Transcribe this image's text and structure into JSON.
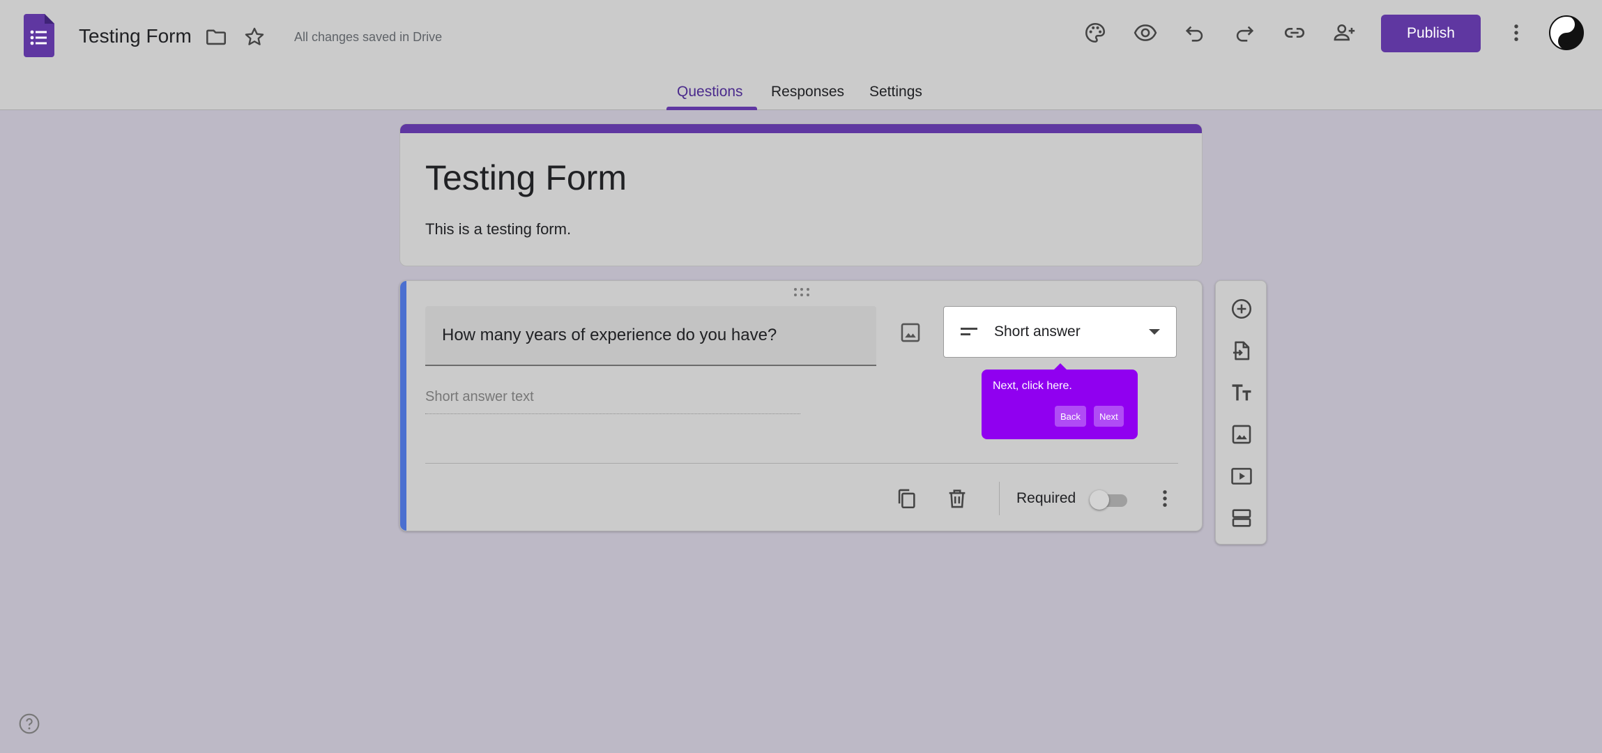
{
  "app": {
    "logo_icon": "google-forms-icon"
  },
  "header": {
    "doc_title": "Testing Form",
    "save_status": "All changes saved in Drive",
    "publish_label": "Publish",
    "icons": [
      "folder-icon",
      "star-icon",
      "palette-icon",
      "preview-eye-icon",
      "undo-icon",
      "redo-icon",
      "link-icon",
      "add-collaborator-icon",
      "more-vert-icon"
    ]
  },
  "tabs": [
    {
      "label": "Questions",
      "active": true
    },
    {
      "label": "Responses",
      "active": false
    },
    {
      "label": "Settings",
      "active": false
    }
  ],
  "form": {
    "title": "Testing Form",
    "description": "This is a testing form."
  },
  "question": {
    "text": "How many years of experience do you have?",
    "type": "Short answer",
    "answer_placeholder": "Short answer text",
    "required_label": "Required",
    "required": false
  },
  "tooltip": {
    "message": "Next, click here.",
    "back_label": "Back",
    "next_label": "Next"
  },
  "colors": {
    "brand": "#5f37a1",
    "tooltip": "#9000f0",
    "active_question_bar": "#4a6fd0"
  }
}
